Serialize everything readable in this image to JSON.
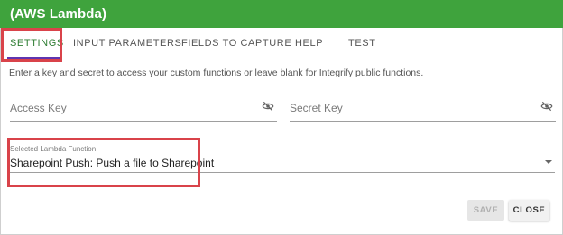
{
  "header": {
    "title": "(AWS Lambda)"
  },
  "tabs": [
    {
      "label": "SETTINGS"
    },
    {
      "label": "INPUT PARAMETERS"
    },
    {
      "label": "FIELDS TO CAPTURE"
    },
    {
      "label": "HELP"
    },
    {
      "label": "TEST"
    }
  ],
  "settings": {
    "instruction": "Enter a key and secret to access your custom functions or leave blank for Integrify public functions.",
    "access_key_label": "Access Key",
    "secret_key_label": "Secret Key",
    "lambda_label": "Selected Lambda Function",
    "lambda_value": "Sharepoint Push: Push a file to Sharepoint"
  },
  "buttons": {
    "save": "SAVE",
    "close": "CLOSE"
  },
  "colors": {
    "header_bg": "#3fa33d",
    "active_tab": "#2e7d32",
    "tab_indicator": "#5e35b1",
    "highlight": "#d9434a"
  },
  "icons": {
    "visibility_toggle": "eye-off-icon",
    "dropdown": "chevron-down-icon"
  }
}
